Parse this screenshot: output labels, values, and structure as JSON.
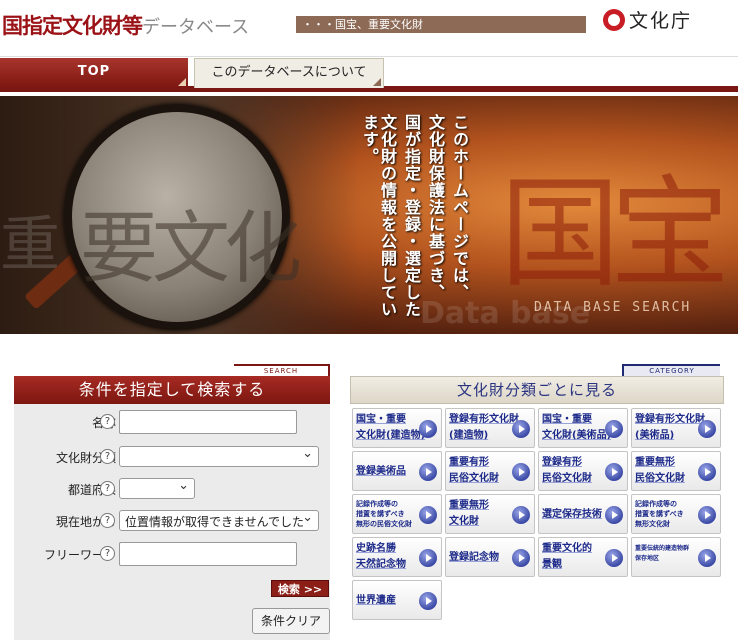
{
  "header": {
    "title": "国指定文化財等",
    "title_suffix": "データベース",
    "tagline": "・・・国宝、重要文化財",
    "agency": "文化庁"
  },
  "nav": {
    "tabs": [
      {
        "label": "TOP",
        "active": true
      },
      {
        "label": "このデータベースについて",
        "active": false
      }
    ]
  },
  "banner": {
    "lines": [
      "このホームページでは、",
      "文化財保護法に基づき、",
      "国が指定・登録・選定した",
      "文化財の情報を公開しています。"
    ],
    "caption": "DATA BASE SEARCH"
  },
  "search": {
    "tag": "SEARCH",
    "title": "条件を指定して検索する",
    "help_icon": "?",
    "fields": {
      "name_label": "名称",
      "name_value": "",
      "category_label": "文化財分類",
      "category_value": "",
      "prefecture_label": "都道府県",
      "prefecture_value": "",
      "location_label": "現在地から",
      "location_value": "位置情報が取得できませんでした",
      "freeword_label": "フリーワード",
      "freeword_value": ""
    },
    "search_button": "検索 >>",
    "clear_button": "条件クリア"
  },
  "category": {
    "tag": "CATEGORY",
    "title": "文化財分類ごとに見る",
    "items": [
      {
        "label": "国宝・重要\n文化財(建造物)"
      },
      {
        "label": "登録有形文化財\n(建造物)"
      },
      {
        "label": "国宝・重要\n文化財(美術品)"
      },
      {
        "label": "登録有形文化財\n(美術品)"
      },
      {
        "label": "登録美術品"
      },
      {
        "label": "重要有形\n民俗文化財"
      },
      {
        "label": "登録有形\n民俗文化財"
      },
      {
        "label": "重要無形\n民俗文化財"
      },
      {
        "label": "記録作成等の\n措置を講ずべき\n無形の民俗文化財"
      },
      {
        "label": "重要無形\n文化財"
      },
      {
        "label": "選定保存技術"
      },
      {
        "label": "記録作成等の\n措置を講ずべき\n無形文化財"
      },
      {
        "label": "史跡名勝\n天然記念物"
      },
      {
        "label": "登録記念物"
      },
      {
        "label": "重要文化的\n景観"
      },
      {
        "label": "重要伝統的建造物群\n保存地区"
      },
      {
        "label": "世界遺産"
      }
    ]
  },
  "colors": {
    "brand_red": "#9b1216",
    "nav_dark": "#7a1712",
    "category_blue": "#1d2a8a"
  }
}
